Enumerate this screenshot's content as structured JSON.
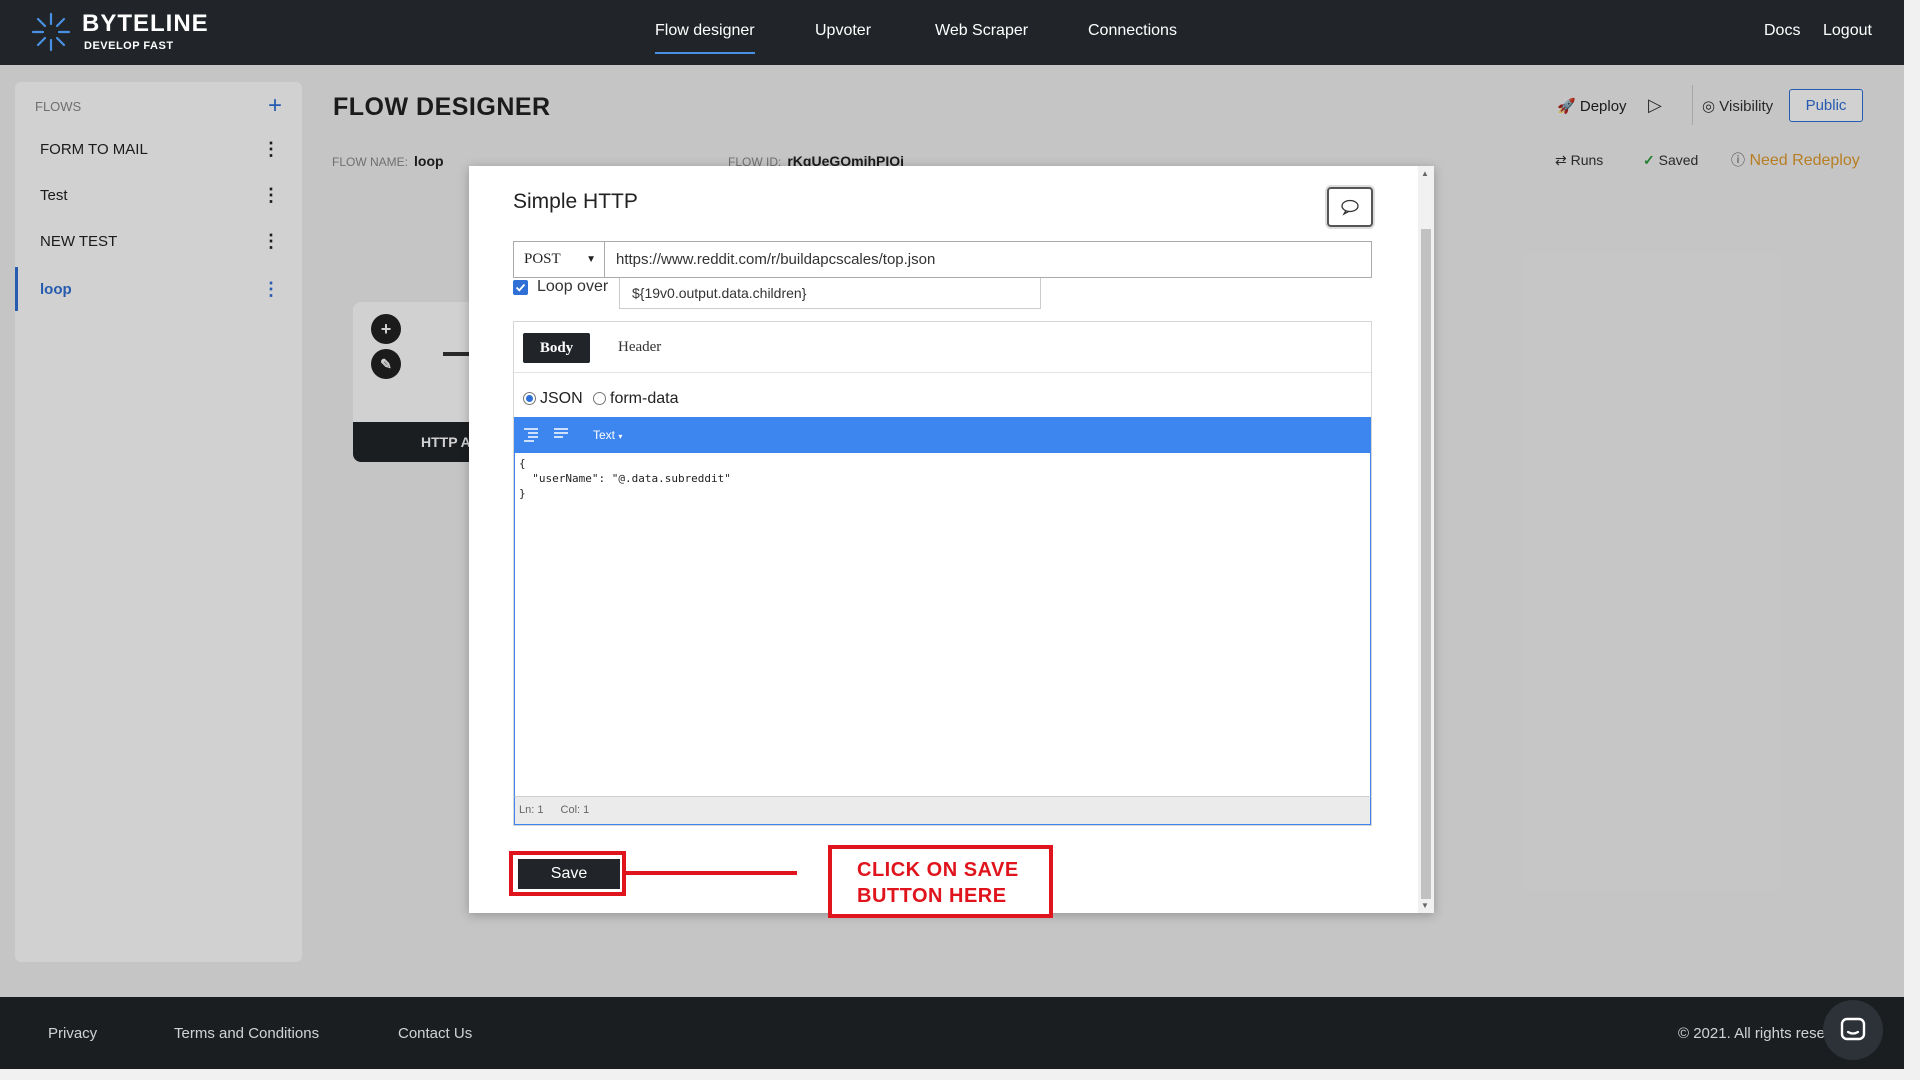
{
  "brand": {
    "name": "BYTELINE",
    "tagline": "DEVELOP FAST"
  },
  "nav": {
    "links": [
      "Flow designer",
      "Upvoter",
      "Web Scraper",
      "Connections"
    ],
    "right": [
      "Docs",
      "Logout"
    ],
    "active": "Flow designer"
  },
  "sidebar": {
    "heading": "FLOWS",
    "add_icon": "+",
    "items": [
      {
        "label": "FORM TO MAIL"
      },
      {
        "label": "Test"
      },
      {
        "label": "NEW TEST"
      },
      {
        "label": "loop",
        "active": true
      }
    ]
  },
  "header": {
    "title": "FLOW DESIGNER",
    "flow_name_label": "FLOW NAME:",
    "flow_name": "loop",
    "flow_id_label": "FLOW ID:",
    "flow_id": "rKqUeGOmihPIOi",
    "deploy": "Deploy",
    "visibility": "Visibility",
    "public": "Public",
    "runs": "Runs",
    "saved": "Saved",
    "need_redeploy": "Need Redeploy"
  },
  "canvas": {
    "node_label": "HTTP A"
  },
  "modal": {
    "title": "Simple HTTP",
    "method": "POST",
    "url": "https://www.reddit.com/r/buildapcscales/top.json",
    "loop_checked": true,
    "loop_label": "Loop over",
    "loop_value": "${19v0.output.data.children}",
    "tabs": [
      "Body",
      "Header"
    ],
    "active_tab": "Body",
    "body_types": [
      "JSON",
      "form-data"
    ],
    "selected_body_type": "JSON",
    "editor_mode": "Text",
    "editor_content": "{\n  \"userName\": \"@.data.subreddit\"\n}",
    "status_ln": "Ln: 1",
    "status_col": "Col: 1",
    "save": "Save"
  },
  "annotation": {
    "callout_line1": "CLICK ON SAVE",
    "callout_line2": "BUTTON HERE",
    "color": "#e0141c"
  },
  "footer": {
    "links": [
      "Privacy",
      "Terms and Conditions",
      "Contact Us"
    ],
    "copyright": "© 2021. All rights rese"
  },
  "colors": {
    "nav_bg": "#212529",
    "accent": "#2f6fd6",
    "editor_bar": "#3d86f0",
    "warning": "#e09a2c",
    "success": "#2e9c3e"
  }
}
